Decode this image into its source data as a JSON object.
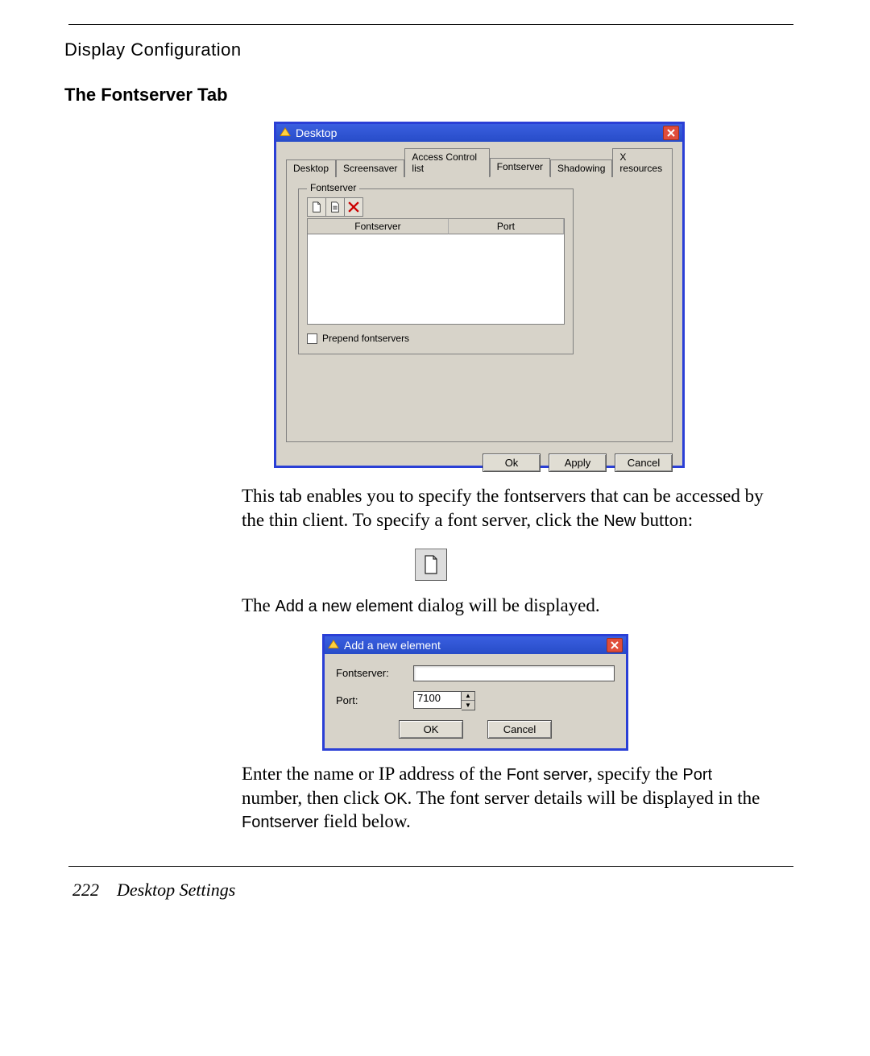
{
  "header": "Display Configuration",
  "section_heading": "The Fontserver Tab",
  "desktop_window": {
    "title": "Desktop",
    "tabs": {
      "desktop": "Desktop",
      "screensaver": "Screensaver",
      "acl": "Access Control list",
      "fontserver": "Fontserver",
      "shadowing": "Shadowing",
      "xres": "X resources"
    },
    "fieldset_legend": "Fontserver",
    "list_headers": {
      "fontserver": "Fontserver",
      "port": "Port"
    },
    "prepend_label": "Prepend fontservers",
    "buttons": {
      "ok": "Ok",
      "apply": "Apply",
      "cancel": "Cancel"
    }
  },
  "paragraph1_a": "This tab enables you to specify the fontservers that can be accessed by the thin client. To specify a font server, click the ",
  "paragraph1_new": "New",
  "paragraph1_b": " button:",
  "paragraph2_a": "The ",
  "paragraph2_cmd": "Add a new element",
  "paragraph2_b": " dialog will be displayed.",
  "add_window": {
    "title": "Add a new element",
    "fontserver_label": "Fontserver:",
    "port_label": "Port:",
    "port_value": "7100",
    "ok": "OK",
    "cancel": "Cancel"
  },
  "paragraph3_a": "Enter the name or IP address of the ",
  "paragraph3_fs": "Font server",
  "paragraph3_b": ", specify the ",
  "paragraph3_port": "Port",
  "paragraph3_c": " number, then click ",
  "paragraph3_ok": "OK",
  "paragraph3_d": ". The font server details will be displayed in the ",
  "paragraph3_fsfield": "Fontserver",
  "paragraph3_e": " field below.",
  "footer": {
    "page_number": "222",
    "section": "Desktop Settings"
  }
}
